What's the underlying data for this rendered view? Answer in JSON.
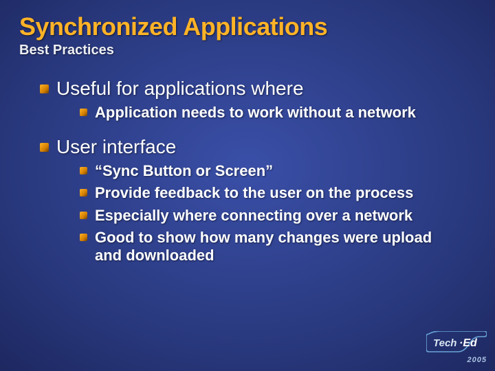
{
  "title": "Synchronized Applications",
  "subtitle": "Best Practices",
  "bullets": [
    {
      "text": "Useful for applications where",
      "sub": [
        "Application needs to work without a network"
      ]
    },
    {
      "text": "User interface",
      "sub": [
        "“Sync Button or Screen”",
        "Provide feedback to the user on the process",
        "Especially where connecting over a network",
        "Good to show how many changes were upload and downloaded"
      ]
    }
  ],
  "branding": {
    "logo_text_1": "Tech",
    "logo_text_2": "Ed",
    "year": "2005"
  }
}
